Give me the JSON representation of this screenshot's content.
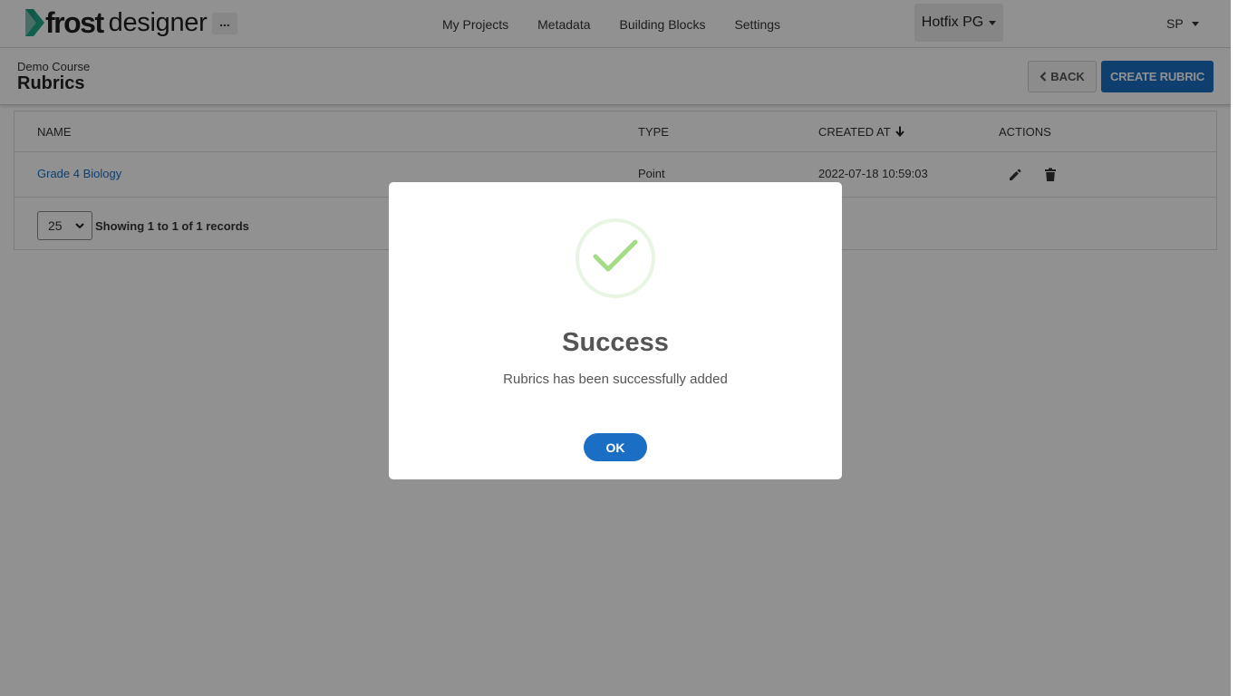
{
  "brand": {
    "name_bold": "frost",
    "name_light": "designer",
    "accent": "#1fa98a"
  },
  "topnav": {
    "more_label": "...",
    "links": [
      "My Projects",
      "Metadata",
      "Building Blocks",
      "Settings"
    ],
    "project": "Hotfix PG",
    "user": "SP"
  },
  "header": {
    "breadcrumb": "Demo Course",
    "title": "Rubrics",
    "back_label": "BACK",
    "create_label": "CREATE RUBRIC"
  },
  "table": {
    "columns": [
      "NAME",
      "TYPE",
      "CREATED AT",
      "ACTIONS"
    ],
    "rows": [
      {
        "name": "Grade 4 Biology",
        "type": "Point",
        "created_at": "2022-07-18 10:59:03"
      }
    ],
    "page_size": "25",
    "records_prefix": "Showing",
    "records_from": "1",
    "records_to_word": "to",
    "records_to": "1",
    "records_of_word": "of",
    "records_total": "1",
    "records_suffix": "records"
  },
  "modal": {
    "title": "Success",
    "message": "Rubrics has been successfully added",
    "ok_label": "OK",
    "icon": "check-icon"
  },
  "colors": {
    "primary": "#1a6fc4",
    "success": "#a5dc86"
  }
}
